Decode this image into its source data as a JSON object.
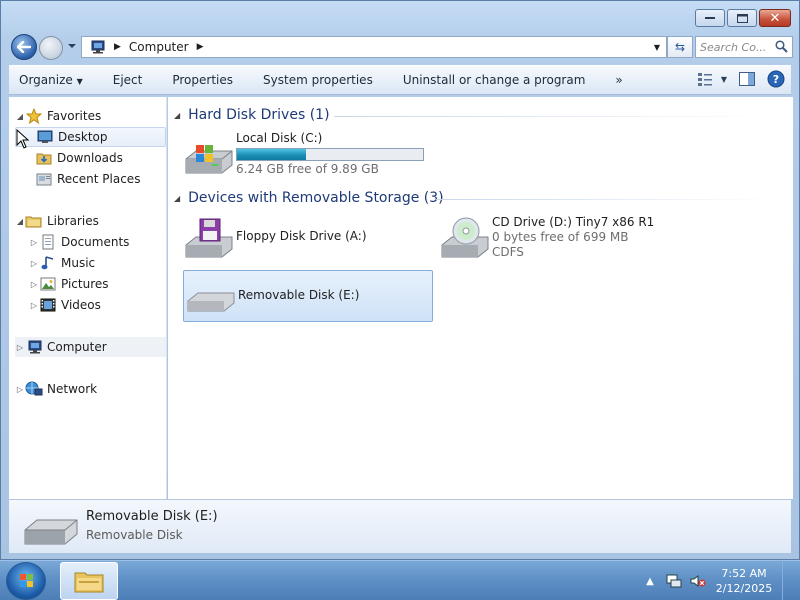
{
  "address": {
    "crumb": "Computer",
    "search_placeholder": "Search Co..."
  },
  "toolbar": {
    "organize": "Organize",
    "eject": "Eject",
    "properties": "Properties",
    "system_properties": "System properties",
    "uninstall": "Uninstall or change a program",
    "more": "»"
  },
  "nav": {
    "favorites": "Favorites",
    "desktop": "Desktop",
    "downloads": "Downloads",
    "recent_places": "Recent Places",
    "libraries": "Libraries",
    "documents": "Documents",
    "music": "Music",
    "pictures": "Pictures",
    "videos": "Videos",
    "computer": "Computer",
    "network": "Network"
  },
  "groups": {
    "hdd": "Hard Disk Drives (1)",
    "removable": "Devices with Removable Storage (3)"
  },
  "drives": {
    "local": {
      "name": "Local Disk (C:)",
      "free": "6.24 GB free of 9.89 GB",
      "used_fraction": 0.369
    },
    "floppy": {
      "name": "Floppy Disk Drive (A:)"
    },
    "cd": {
      "name": "CD Drive (D:) Tiny7 x86 R1",
      "free": "0 bytes free of 699 MB",
      "fs": "CDFS"
    },
    "removable": {
      "name": "Removable Disk (E:)"
    }
  },
  "details": {
    "title": "Removable Disk (E:)",
    "subtitle": "Removable Disk"
  },
  "taskbar": {
    "time": "7:52 AM",
    "date": "2/12/2025",
    "tray_arrow": "▲"
  },
  "colors": {
    "accent": "#1e3a78",
    "selection": "#cfe2f7",
    "bar_fill": "#1a8fb6"
  }
}
